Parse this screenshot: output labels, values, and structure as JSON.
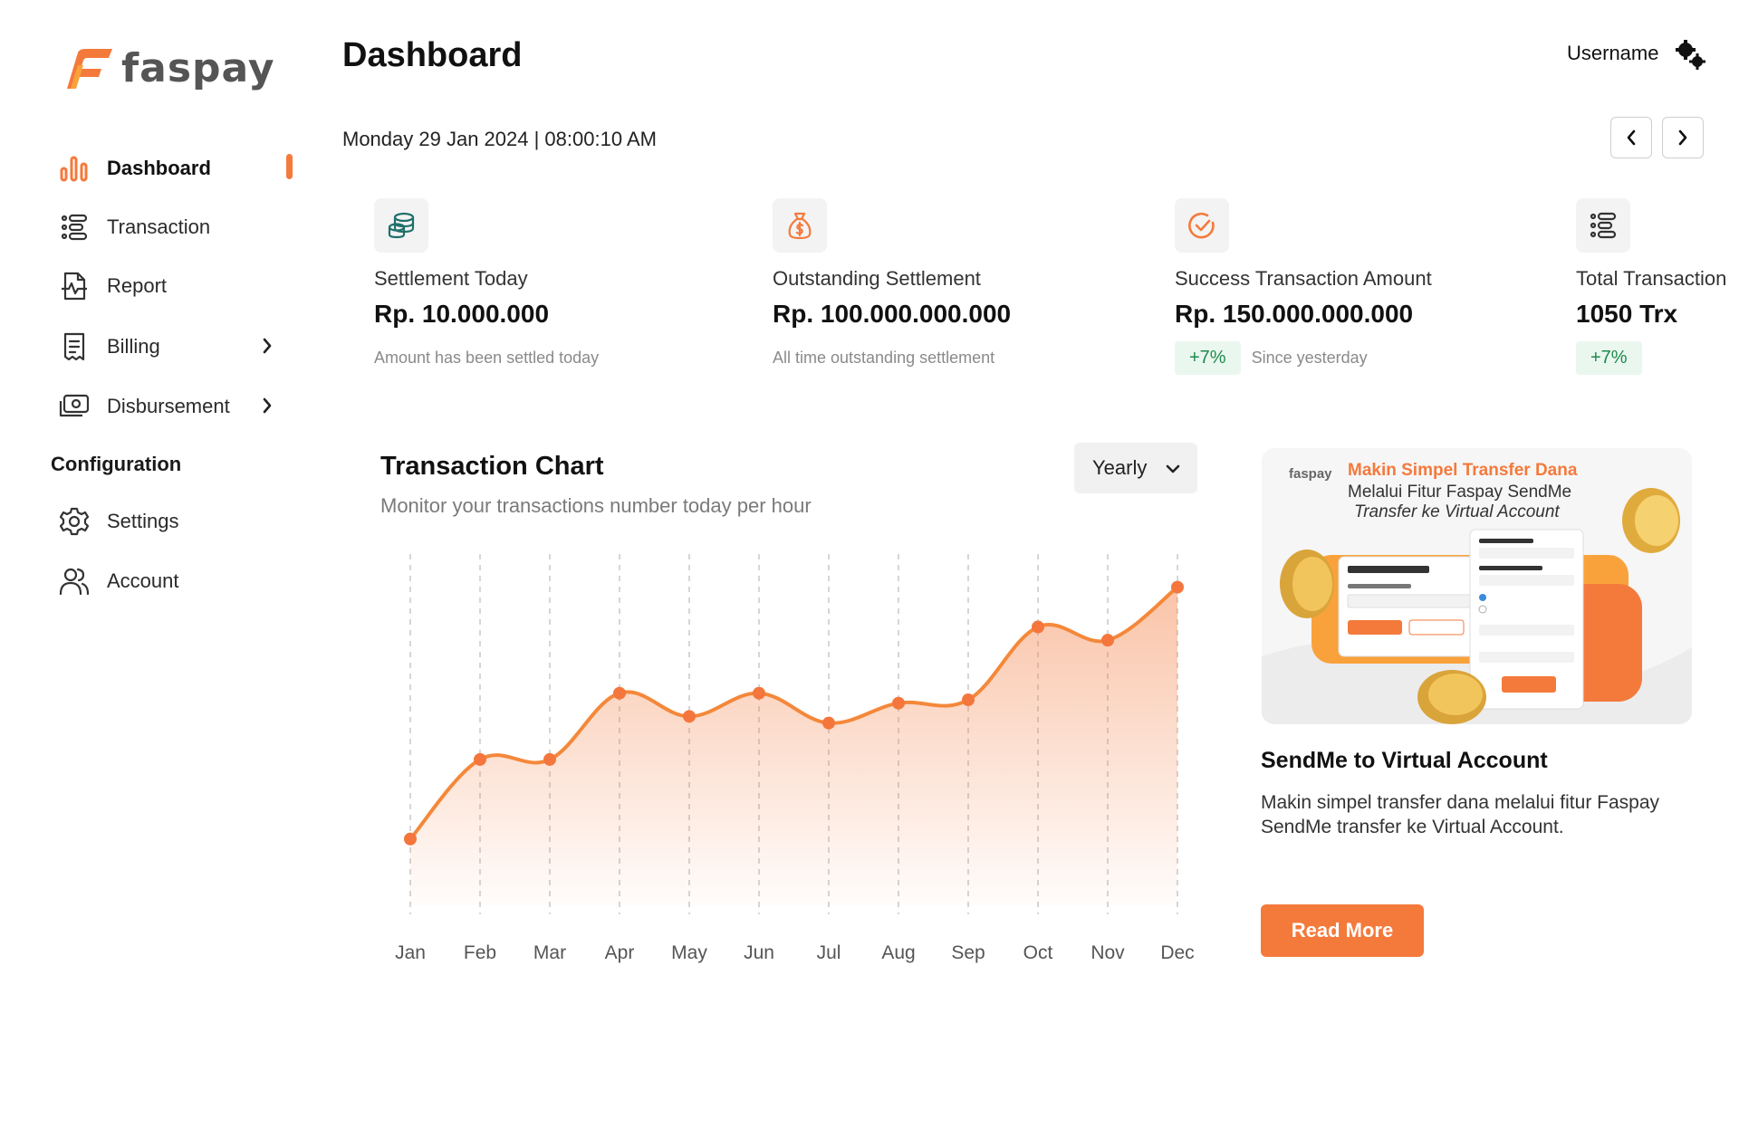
{
  "app": {
    "logo_text": "faspay",
    "accent": "#f47a3c",
    "green": "#1f8a4c"
  },
  "sidebar": {
    "items": [
      {
        "label": "Dashboard",
        "icon": "bar-chart-icon",
        "active": true
      },
      {
        "label": "Transaction",
        "icon": "list-icon"
      },
      {
        "label": "Report",
        "icon": "report-icon"
      },
      {
        "label": "Billing",
        "icon": "receipt-icon",
        "has_submenu": true
      },
      {
        "label": "Disbursement",
        "icon": "money-icon",
        "has_submenu": true
      }
    ],
    "config_title": "Configuration",
    "config_items": [
      {
        "label": "Settings",
        "icon": "gear-icon"
      },
      {
        "label": "Account",
        "icon": "users-icon"
      }
    ]
  },
  "header": {
    "title": "Dashboard",
    "username": "Username",
    "datetime": "Monday 29 Jan 2024 | 08:00:10 AM"
  },
  "stats": [
    {
      "label": "Settlement Today",
      "value": "Rp. 10.000.000",
      "note": "Amount has been settled today",
      "icon": "coins-icon"
    },
    {
      "label": "Outstanding Settlement",
      "value": "Rp. 100.000.000.000",
      "note": "All time outstanding settlement",
      "icon": "money-bag-icon"
    },
    {
      "label": "Success Transaction Amount",
      "value": "Rp. 150.000.000.000",
      "badge": "+7%",
      "note": "Since yesterday",
      "icon": "check-circle-icon"
    },
    {
      "label": "Total Transaction",
      "value": "1050 Trx",
      "badge": "+7%",
      "icon": "list-icon"
    }
  ],
  "chart": {
    "title": "Transaction Chart",
    "subtitle": "Monitor your transactions number today per hour",
    "period_selected": "Yearly"
  },
  "chart_data": {
    "type": "area",
    "categories": [
      "Jan",
      "Feb",
      "Mar",
      "Apr",
      "May",
      "Jun",
      "Jul",
      "Aug",
      "Sep",
      "Oct",
      "Nov",
      "Dec"
    ],
    "values": [
      14,
      38,
      38,
      58,
      51,
      58,
      49,
      55,
      56,
      78,
      74,
      90
    ],
    "ylim": [
      0,
      100
    ],
    "grid": "vertical-dashed"
  },
  "promo": {
    "image_brand": "faspay",
    "image_headline": "Makin Simpel Transfer Dana",
    "image_line1": "Melalui Fitur Faspay SendMe",
    "image_line2": "Transfer ke Virtual Account",
    "title": "SendMe to Virtual Account",
    "description": "Makin simpel transfer dana melalui fitur Faspay SendMe transfer ke Virtual Account.",
    "button": "Read More"
  }
}
